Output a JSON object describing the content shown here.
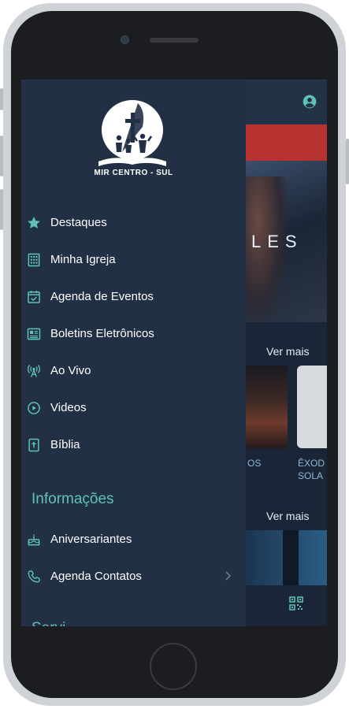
{
  "drawer": {
    "logo_text": "MIR CENTRO - SUL",
    "menu": [
      {
        "label": "Destaques",
        "icon": "star-icon"
      },
      {
        "label": "Minha Igreja",
        "icon": "building-icon"
      },
      {
        "label": "Agenda de Eventos",
        "icon": "calendar-check-icon"
      },
      {
        "label": "Boletins Eletrônicos",
        "icon": "newspaper-icon"
      },
      {
        "label": "Ao Vivo",
        "icon": "broadcast-icon"
      },
      {
        "label": "Videos",
        "icon": "play-circle-icon"
      },
      {
        "label": "Bíblia",
        "icon": "bible-icon"
      }
    ],
    "section_title": "Informações",
    "info_menu": [
      {
        "label": "Aniversariantes",
        "icon": "cake-icon"
      },
      {
        "label": "Agenda Contatos",
        "icon": "phone-icon"
      }
    ],
    "partial_section_title": "Servi"
  },
  "background": {
    "hero_text": "LES",
    "ver_mais_1": "Ver mais",
    "ver_mais_2": "Ver mais",
    "thumb1_label": "OS",
    "thumb2_label_line1": "ÊXOD",
    "thumb2_label_line2": "SOLA"
  },
  "colors": {
    "drawer_bg": "#223045",
    "accent_teal": "#5ec3b6",
    "banner_red": "#b8322f"
  }
}
